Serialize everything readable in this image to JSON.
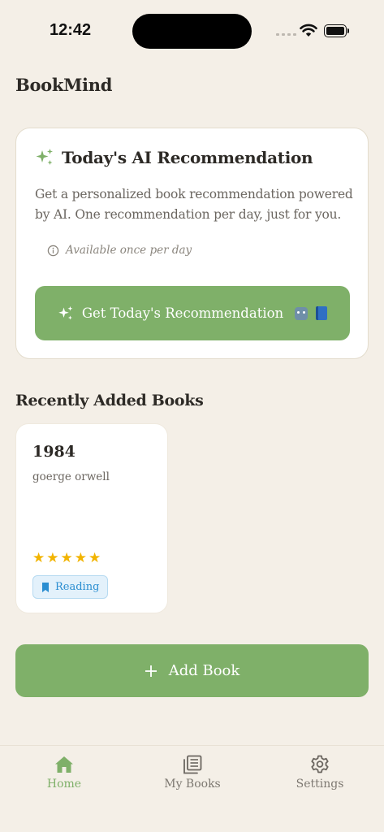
{
  "status_bar": {
    "time": "12:42"
  },
  "app": {
    "title": "BookMind"
  },
  "recommendation": {
    "title": "Today's AI Recommendation",
    "description": "Get a personalized book recommendation powered by AI. One recommendation per day, just for you.",
    "note": "Available once per day",
    "button_label": "Get Today's Recommendation"
  },
  "recent": {
    "section_title": "Recently Added Books",
    "books": [
      {
        "title": "1984",
        "author": "goerge orwell",
        "rating": 5,
        "rating_max": 5,
        "status": "Reading"
      }
    ]
  },
  "add_book": {
    "label": "Add Book"
  },
  "tabs": [
    {
      "label": "Home",
      "icon": "home-icon",
      "active": true
    },
    {
      "label": "My Books",
      "icon": "books-icon",
      "active": false
    },
    {
      "label": "Settings",
      "icon": "gear-icon",
      "active": false
    }
  ],
  "colors": {
    "accent": "#7fb069",
    "background": "#f4efe7",
    "star": "#f2b400",
    "status_badge": "#2b8ed1"
  }
}
